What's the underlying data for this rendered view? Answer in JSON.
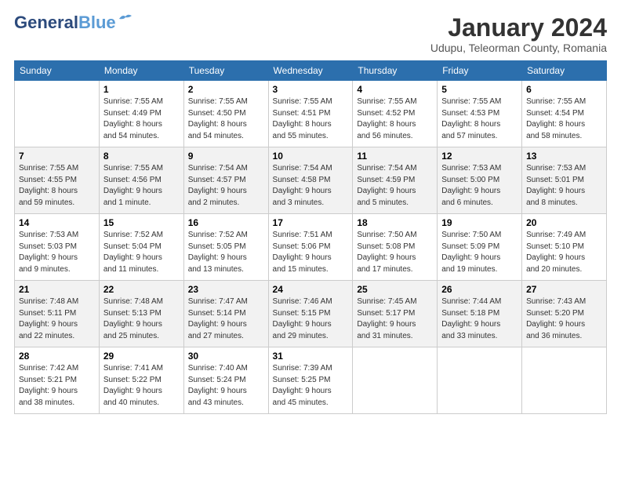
{
  "logo": {
    "line1": "General",
    "line2": "Blue"
  },
  "title": "January 2024",
  "location": "Udupu, Teleorman County, Romania",
  "days_header": [
    "Sunday",
    "Monday",
    "Tuesday",
    "Wednesday",
    "Thursday",
    "Friday",
    "Saturday"
  ],
  "weeks": [
    [
      {
        "day": "",
        "info": ""
      },
      {
        "day": "1",
        "info": "Sunrise: 7:55 AM\nSunset: 4:49 PM\nDaylight: 8 hours\nand 54 minutes."
      },
      {
        "day": "2",
        "info": "Sunrise: 7:55 AM\nSunset: 4:50 PM\nDaylight: 8 hours\nand 54 minutes."
      },
      {
        "day": "3",
        "info": "Sunrise: 7:55 AM\nSunset: 4:51 PM\nDaylight: 8 hours\nand 55 minutes."
      },
      {
        "day": "4",
        "info": "Sunrise: 7:55 AM\nSunset: 4:52 PM\nDaylight: 8 hours\nand 56 minutes."
      },
      {
        "day": "5",
        "info": "Sunrise: 7:55 AM\nSunset: 4:53 PM\nDaylight: 8 hours\nand 57 minutes."
      },
      {
        "day": "6",
        "info": "Sunrise: 7:55 AM\nSunset: 4:54 PM\nDaylight: 8 hours\nand 58 minutes."
      }
    ],
    [
      {
        "day": "7",
        "info": "Sunrise: 7:55 AM\nSunset: 4:55 PM\nDaylight: 8 hours\nand 59 minutes."
      },
      {
        "day": "8",
        "info": "Sunrise: 7:55 AM\nSunset: 4:56 PM\nDaylight: 9 hours\nand 1 minute."
      },
      {
        "day": "9",
        "info": "Sunrise: 7:54 AM\nSunset: 4:57 PM\nDaylight: 9 hours\nand 2 minutes."
      },
      {
        "day": "10",
        "info": "Sunrise: 7:54 AM\nSunset: 4:58 PM\nDaylight: 9 hours\nand 3 minutes."
      },
      {
        "day": "11",
        "info": "Sunrise: 7:54 AM\nSunset: 4:59 PM\nDaylight: 9 hours\nand 5 minutes."
      },
      {
        "day": "12",
        "info": "Sunrise: 7:53 AM\nSunset: 5:00 PM\nDaylight: 9 hours\nand 6 minutes."
      },
      {
        "day": "13",
        "info": "Sunrise: 7:53 AM\nSunset: 5:01 PM\nDaylight: 9 hours\nand 8 minutes."
      }
    ],
    [
      {
        "day": "14",
        "info": "Sunrise: 7:53 AM\nSunset: 5:03 PM\nDaylight: 9 hours\nand 9 minutes."
      },
      {
        "day": "15",
        "info": "Sunrise: 7:52 AM\nSunset: 5:04 PM\nDaylight: 9 hours\nand 11 minutes."
      },
      {
        "day": "16",
        "info": "Sunrise: 7:52 AM\nSunset: 5:05 PM\nDaylight: 9 hours\nand 13 minutes."
      },
      {
        "day": "17",
        "info": "Sunrise: 7:51 AM\nSunset: 5:06 PM\nDaylight: 9 hours\nand 15 minutes."
      },
      {
        "day": "18",
        "info": "Sunrise: 7:50 AM\nSunset: 5:08 PM\nDaylight: 9 hours\nand 17 minutes."
      },
      {
        "day": "19",
        "info": "Sunrise: 7:50 AM\nSunset: 5:09 PM\nDaylight: 9 hours\nand 19 minutes."
      },
      {
        "day": "20",
        "info": "Sunrise: 7:49 AM\nSunset: 5:10 PM\nDaylight: 9 hours\nand 20 minutes."
      }
    ],
    [
      {
        "day": "21",
        "info": "Sunrise: 7:48 AM\nSunset: 5:11 PM\nDaylight: 9 hours\nand 22 minutes."
      },
      {
        "day": "22",
        "info": "Sunrise: 7:48 AM\nSunset: 5:13 PM\nDaylight: 9 hours\nand 25 minutes."
      },
      {
        "day": "23",
        "info": "Sunrise: 7:47 AM\nSunset: 5:14 PM\nDaylight: 9 hours\nand 27 minutes."
      },
      {
        "day": "24",
        "info": "Sunrise: 7:46 AM\nSunset: 5:15 PM\nDaylight: 9 hours\nand 29 minutes."
      },
      {
        "day": "25",
        "info": "Sunrise: 7:45 AM\nSunset: 5:17 PM\nDaylight: 9 hours\nand 31 minutes."
      },
      {
        "day": "26",
        "info": "Sunrise: 7:44 AM\nSunset: 5:18 PM\nDaylight: 9 hours\nand 33 minutes."
      },
      {
        "day": "27",
        "info": "Sunrise: 7:43 AM\nSunset: 5:20 PM\nDaylight: 9 hours\nand 36 minutes."
      }
    ],
    [
      {
        "day": "28",
        "info": "Sunrise: 7:42 AM\nSunset: 5:21 PM\nDaylight: 9 hours\nand 38 minutes."
      },
      {
        "day": "29",
        "info": "Sunrise: 7:41 AM\nSunset: 5:22 PM\nDaylight: 9 hours\nand 40 minutes."
      },
      {
        "day": "30",
        "info": "Sunrise: 7:40 AM\nSunset: 5:24 PM\nDaylight: 9 hours\nand 43 minutes."
      },
      {
        "day": "31",
        "info": "Sunrise: 7:39 AM\nSunset: 5:25 PM\nDaylight: 9 hours\nand 45 minutes."
      },
      {
        "day": "",
        "info": ""
      },
      {
        "day": "",
        "info": ""
      },
      {
        "day": "",
        "info": ""
      }
    ]
  ]
}
